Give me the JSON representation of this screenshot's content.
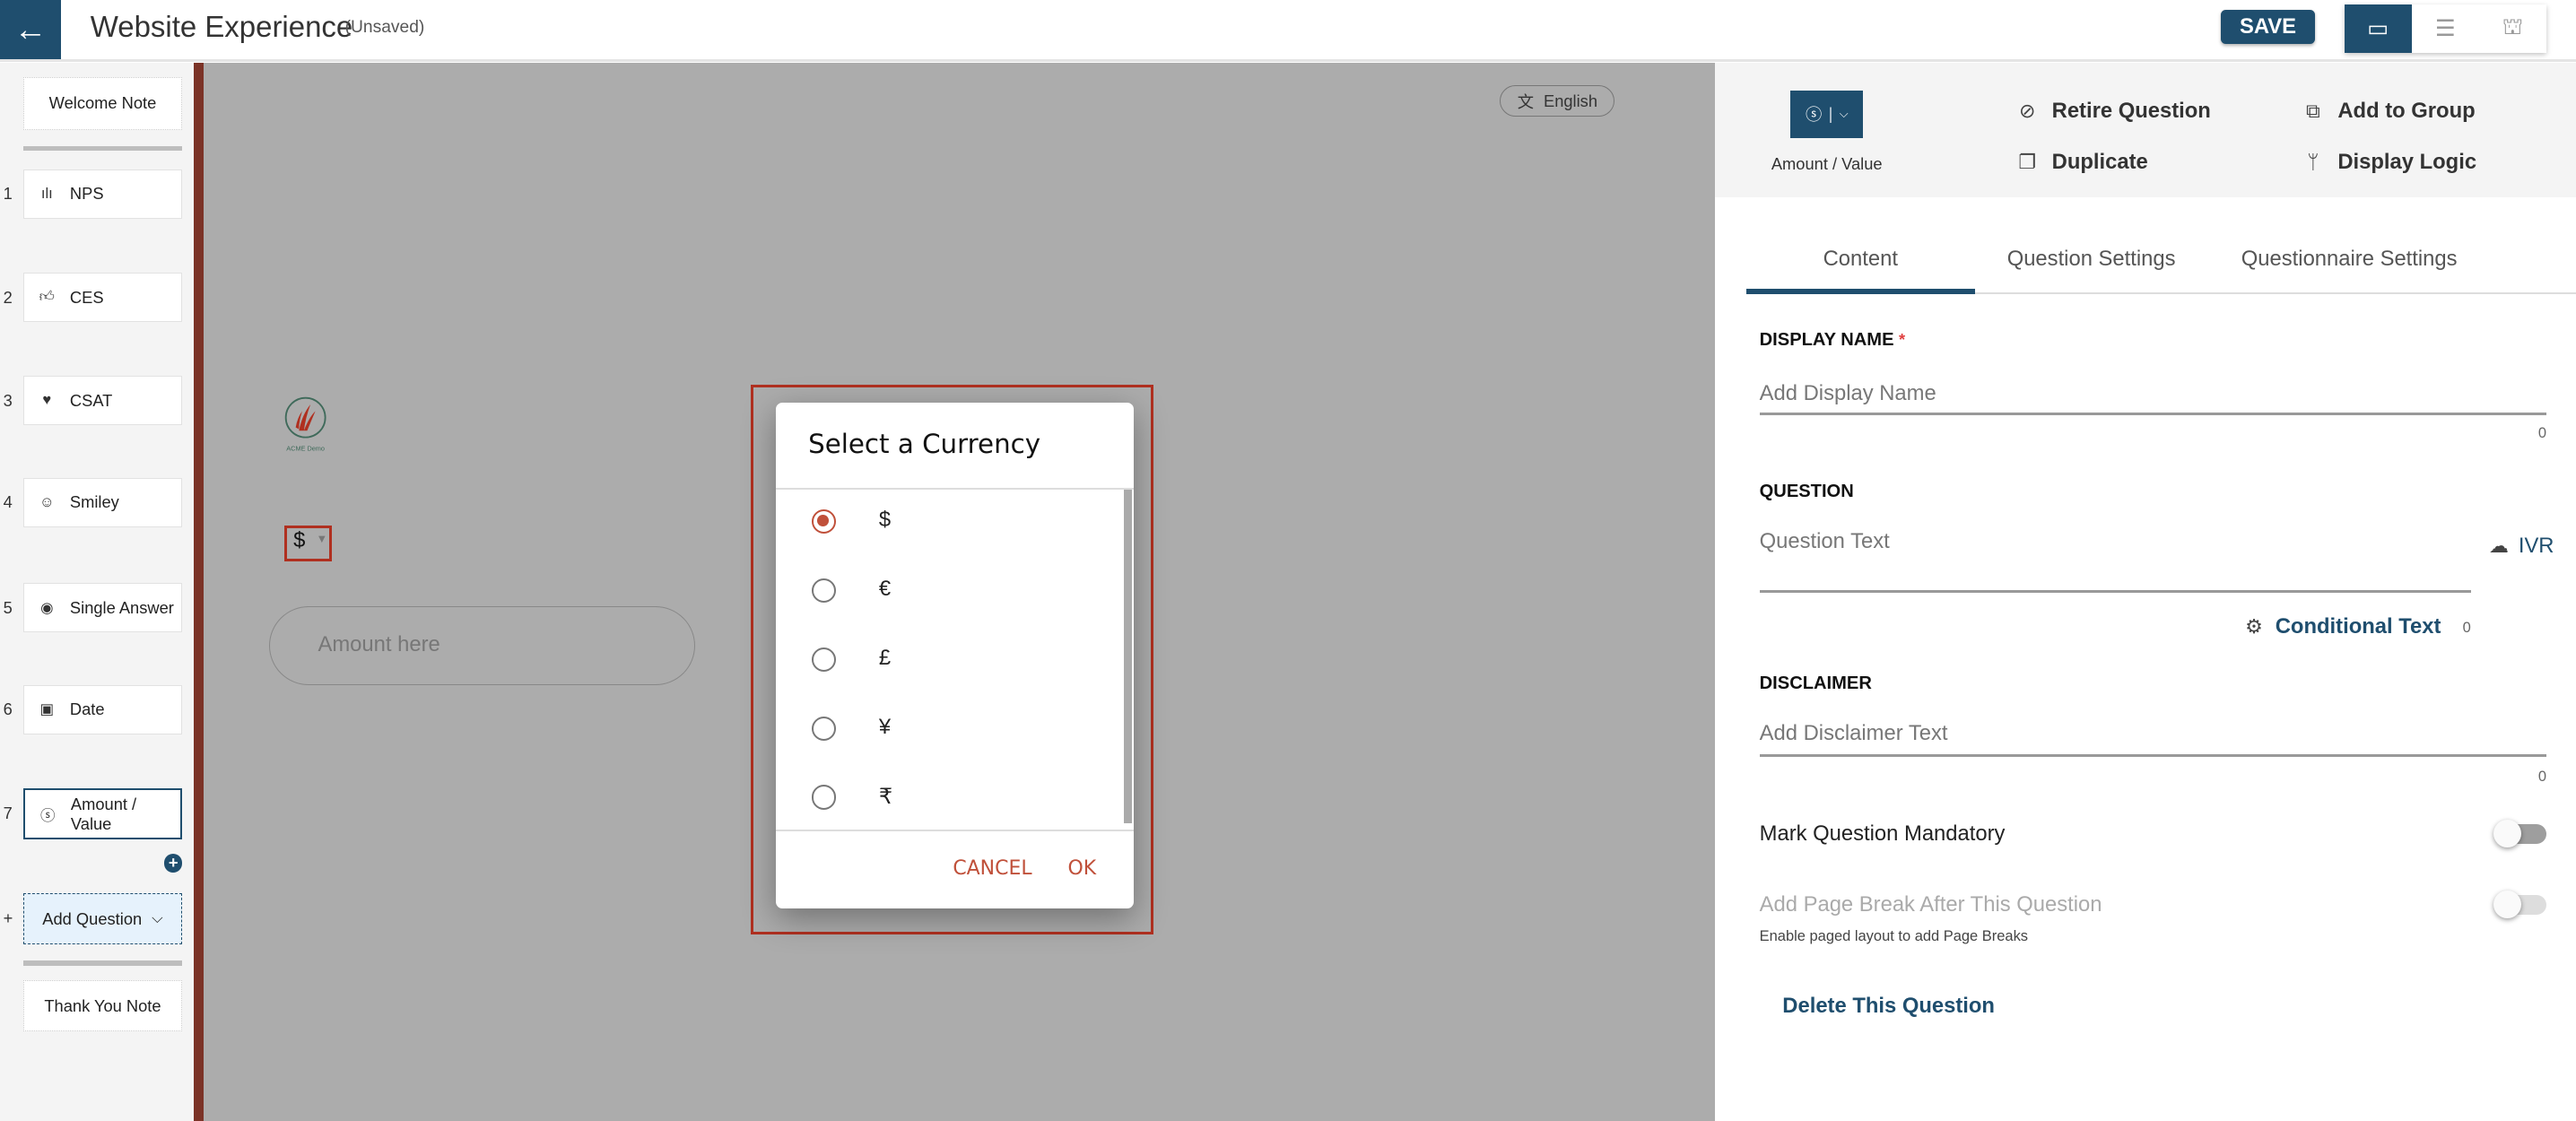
{
  "header": {
    "back_icon": "arrow-left-icon",
    "title": "Website Experience",
    "status": "(Unsaved)",
    "save_label": "SAVE",
    "view_modes": [
      "desktop-icon",
      "list-icon",
      "sitemap-icon"
    ],
    "active_view": "desktop"
  },
  "sidebar": {
    "welcome": "Welcome Note",
    "questions": [
      {
        "num": "1",
        "label": "NPS",
        "icon": "nps-bars-icon"
      },
      {
        "num": "2",
        "label": "CES",
        "icon": "thumbs-up-icon"
      },
      {
        "num": "3",
        "label": "CSAT",
        "icon": "heart-icon"
      },
      {
        "num": "4",
        "label": "Smiley",
        "icon": "smiley-icon"
      },
      {
        "num": "5",
        "label": "Single Answer",
        "icon": "radio-icon"
      },
      {
        "num": "6",
        "label": "Date",
        "icon": "calendar-icon"
      },
      {
        "num": "7",
        "label": "Amount / Value",
        "icon": "dollar-coin-icon",
        "selected": true
      }
    ],
    "add_prefix": "+",
    "add_question": "Add Question",
    "thank_you": "Thank You Note"
  },
  "canvas": {
    "language": "English",
    "logo_text": "ACME Demo",
    "currency_value": "$",
    "amount_placeholder": "Amount here"
  },
  "dialog": {
    "title": "Select a Currency",
    "options": [
      "$",
      "€",
      "£",
      "¥",
      "₹"
    ],
    "selected": "$",
    "cancel": "CANCEL",
    "ok": "OK",
    "accent": "#c0503a"
  },
  "panel": {
    "type_label": "Amount / Value",
    "actions": {
      "retire": "Retire Question",
      "duplicate": "Duplicate",
      "add_group": "Add to Group",
      "display_logic": "Display Logic"
    },
    "tabs": [
      "Content",
      "Question Settings",
      "Questionnaire Settings"
    ],
    "active_tab": "Content",
    "display_name_label": "DISPLAY NAME",
    "required_mark": "*",
    "display_name_placeholder": "Add Display Name",
    "display_name_count": "0",
    "question_label": "QUESTION",
    "question_placeholder": "Question Text",
    "ivr": "IVR",
    "conditional_text": "Conditional Text",
    "conditional_count": "0",
    "disclaimer_label": "DISCLAIMER",
    "disclaimer_placeholder": "Add Disclaimer Text",
    "disclaimer_count": "0",
    "mandatory_label": "Mark Question Mandatory",
    "mandatory_on": false,
    "page_break_label": "Add Page Break After This Question",
    "page_break_on": false,
    "page_break_hint": "Enable paged layout to add Page Breaks",
    "delete": "Delete This Question"
  },
  "colors": {
    "primary": "#1f4e6e",
    "accent_red": "#b03020",
    "sidebar_bar": "#7b3327"
  }
}
